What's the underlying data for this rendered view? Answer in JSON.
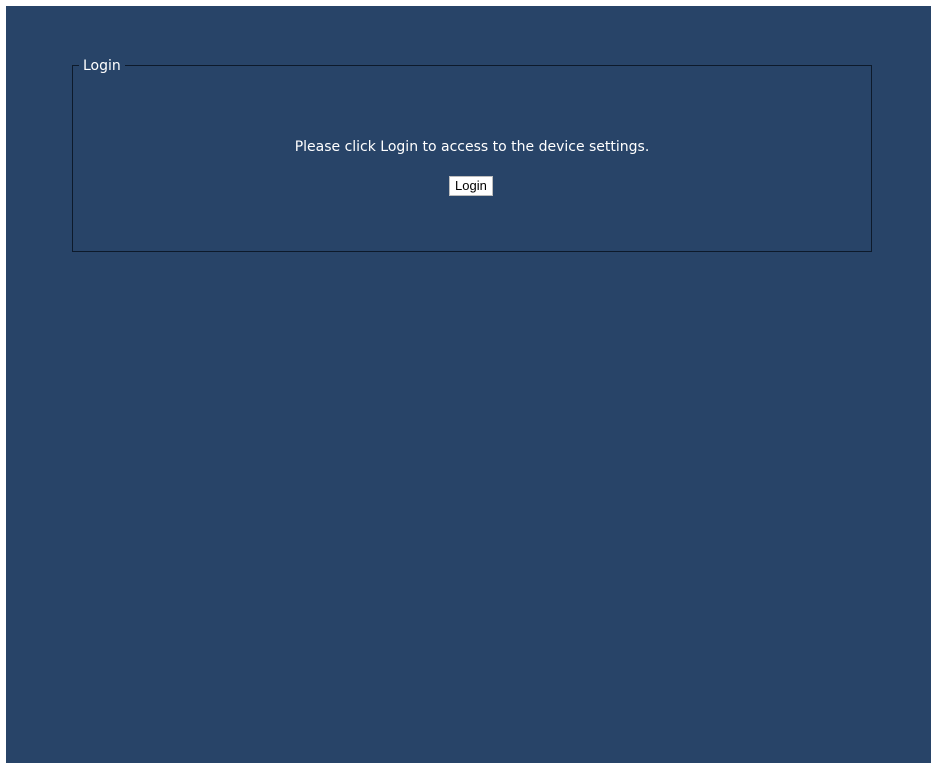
{
  "login_panel": {
    "legend": "Login",
    "message": "Please click Login to access to the device settings.",
    "button_label": "Login"
  },
  "colors": {
    "background": "#284468",
    "border": "#0d1a2b",
    "text": "#ffffff",
    "button_background": "#ffffff"
  }
}
